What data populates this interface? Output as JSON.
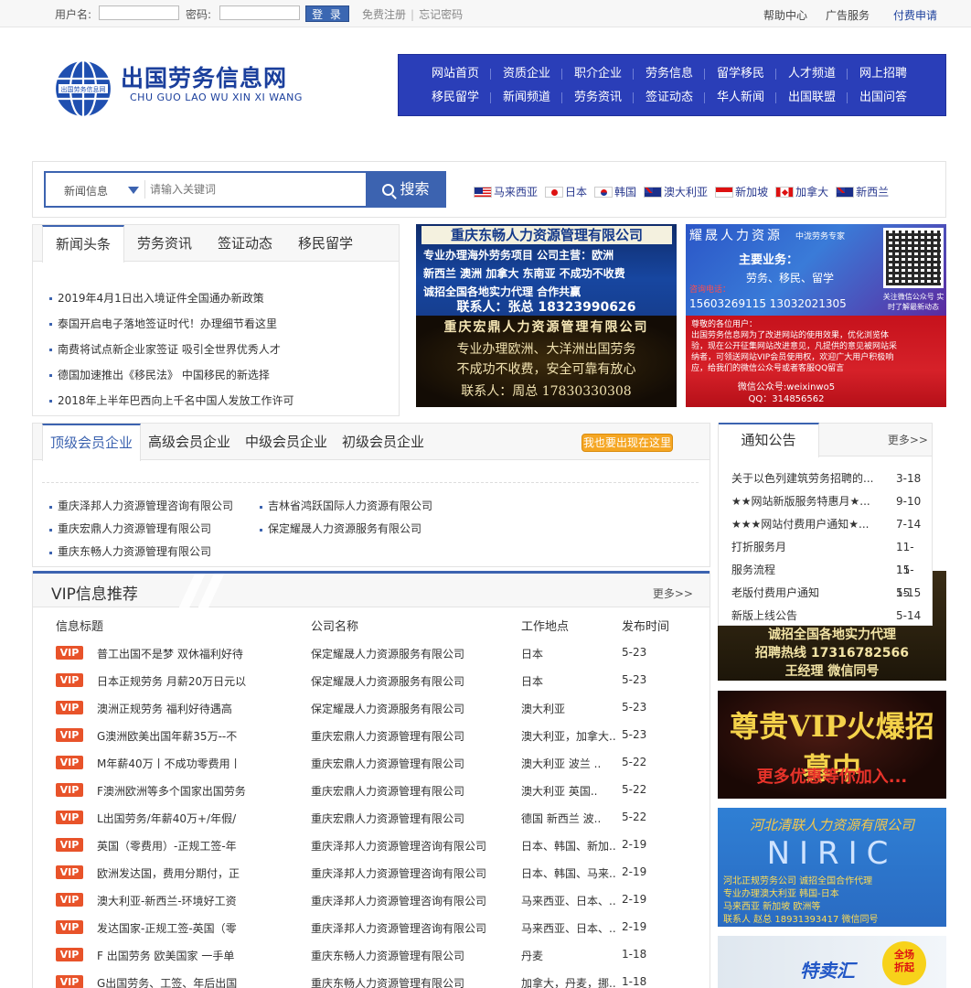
{
  "topbar": {
    "username_label": "用户名:",
    "password_label": "密码:",
    "login_label": "登 录",
    "register": "免费注册",
    "forgot": "忘记密码",
    "help": "帮助中心",
    "ads": "广告服务",
    "paid": "付费申请"
  },
  "logo": {
    "badge_text": "出国劳务信息网",
    "title": "出国劳务信息网",
    "subtitle": "CHU GUO LAO WU XIN XI WANG"
  },
  "nav": {
    "row1": [
      "网站首页",
      "资质企业",
      "职介企业",
      "劳务信息",
      "留学移民",
      "人才频道",
      "网上招聘"
    ],
    "row2": [
      "移民留学",
      "新闻频道",
      "劳务资讯",
      "签证动态",
      "华人新闻",
      "出国联盟",
      "出国问答"
    ]
  },
  "search": {
    "category": "新闻信息",
    "placeholder": "请输入关键词",
    "button": "搜索"
  },
  "flags": [
    "马来西亚",
    "日本",
    "韩国",
    "澳大利亚",
    "新加坡",
    "加拿大",
    "新西兰"
  ],
  "news": {
    "tabs": [
      "新闻头条",
      "劳务资讯",
      "签证动态",
      "移民留学"
    ],
    "items": [
      "2019年4月1日出入境证件全国通办新政策",
      "泰国开启电子落地签证时代！办理细节看这里",
      "南费将试点新企业家签证 吸引全世界优秀人才",
      "德国加速推出《移民法》 中国移民的新选择",
      "2018年上半年巴西向上千名中国人发放工作许可"
    ]
  },
  "ads": {
    "ad1_title": "重庆东畅人力资源管理有限公司",
    "ad1_line1": "专业办理海外劳务项目    公司主营：欧洲",
    "ad1_line2": "新西兰 澳洲 加拿大 东南亚   不成功不收费",
    "ad1_line3": "诚招全国各地实力代理    合作共赢",
    "ad1_contact": "联系人：张总  18323990626",
    "ad2_title": "重庆宏鼎人力资源管理有限公司",
    "ad2_line1": "专业办理欧洲、大洋洲出国劳务",
    "ad2_line2": "不成功不收费，安全可靠有放心",
    "ad2_contact": "联系人：周总    17830330308",
    "ad3_title": "耀晟人力资源",
    "ad3_tag": "中泷劳务专家",
    "ad3_business_label": "主要业务：",
    "ad3_business": "劳务、移民、留学",
    "ad3_hotline_label": "咨询电话：",
    "ad3_phones": "15603269115   13032021305",
    "ad3_qr_caption": "关注微信公众号 实时了解最新动态",
    "ad4_greeting": "尊敬的各位用户：",
    "ad4_body": "出国劳务信息网为了改进网站的使用效果，优化浏览体验，现在公开征集网站改进意见，凡提供的意见被网站采纳者，可领送网站VIP会员使用权，欢迎广大用户积极响应，给我们的微信公众号或者客服QQ留言",
    "ad4_wechat": "微信公众号:weixinwo5",
    "ad4_qq": "QQ：314856562"
  },
  "members": {
    "tabs": [
      "顶级会员企业",
      "高级会员企业",
      "中级会员企业",
      "初级会员企业"
    ],
    "join": "我也要出现在这里",
    "col1": [
      "重庆泽邦人力资源管理咨询有限公司",
      "重庆宏鼎人力资源管理有限公司",
      "重庆东畅人力资源管理有限公司"
    ],
    "col2": [
      "吉林省鸿跃国际人力资源有限公司",
      "保定耀晟人力资源服务有限公司"
    ]
  },
  "notice": {
    "title": "通知公告",
    "more": "更多>>",
    "items": [
      {
        "title": "关于以色列建筑劳务招聘的...",
        "date": "3-18"
      },
      {
        "title": "★★网站新版服务特惠月★...",
        "date": "9-10"
      },
      {
        "title": "★★★网站付费用户通知★...",
        "date": "7-14"
      },
      {
        "title": "打折服务月",
        "date": "11-15"
      },
      {
        "title": "服务流程",
        "date": "11-15"
      },
      {
        "title": "老版付费用户通知",
        "date": "5-15"
      },
      {
        "title": "新版上线公告",
        "date": "5-14"
      }
    ]
  },
  "right_ads": {
    "rad1_line1": "诚招全国各地实力代理",
    "rad1_line2": "招聘热线  17316782566",
    "rad1_line3": "王经理   微信同号",
    "rad2_title": "尊贵VIP火爆招募中",
    "rad2_sub": "更多优惠等你加入...",
    "rad3_title": "河北清联人力资源有限公司",
    "rad3_brand": "NIRIC",
    "rad3_line1": "河北正规劳务公司  诚招全国合作代理",
    "rad3_line2": "专业办理澳大利亚 韩国-日本",
    "rad3_line3": "马来西亚 新加坡 欧洲等",
    "rad3_contact": "联系人 赵总 18931393417 微信同号",
    "rad4_title": "特卖汇",
    "rad4_badge_line1": "全场",
    "rad4_badge_line2": "折起"
  },
  "vip": {
    "title": "VIP信息推荐",
    "more": "更多>>",
    "columns": [
      "信息标题",
      "公司名称",
      "工作地点",
      "发布时间"
    ],
    "badge": "VIP",
    "rows": [
      {
        "title": "普工出国不是梦 双休福利好待",
        "company": "保定耀晟人力资源服务有限公司",
        "location": "日本",
        "date": "5-23"
      },
      {
        "title": "日本正规劳务 月薪20万日元以",
        "company": "保定耀晟人力资源服务有限公司",
        "location": "日本",
        "date": "5-23"
      },
      {
        "title": "澳洲正规劳务 福利好待遇高",
        "company": "保定耀晟人力资源服务有限公司",
        "location": "澳大利亚",
        "date": "5-23"
      },
      {
        "title": "G澳洲欧美出国年薪35万--不",
        "company": "重庆宏鼎人力资源管理有限公司",
        "location": "澳大利亚，加拿大..",
        "date": "5-23"
      },
      {
        "title": "M年薪40万丨不成功零费用丨",
        "company": "重庆宏鼎人力资源管理有限公司",
        "location": "澳大利亚 波兰 ..",
        "date": "5-22"
      },
      {
        "title": "F澳洲欧洲等多个国家出国劳务",
        "company": "重庆宏鼎人力资源管理有限公司",
        "location": "澳大利亚 英国..",
        "date": "5-22"
      },
      {
        "title": "L出国劳务/年薪40万+/年假/",
        "company": "重庆宏鼎人力资源管理有限公司",
        "location": "德国 新西兰 波..",
        "date": "5-22"
      },
      {
        "title": "英国（零费用）-正规工签-年",
        "company": "重庆泽邦人力资源管理咨询有限公司",
        "location": "日本、韩国、新加..",
        "date": "2-19"
      },
      {
        "title": "欧洲发达国，费用分期付，正",
        "company": "重庆泽邦人力资源管理咨询有限公司",
        "location": "日本、韩国、马来..",
        "date": "2-19"
      },
      {
        "title": "澳大利亚-新西兰-环境好工资",
        "company": "重庆泽邦人力资源管理咨询有限公司",
        "location": "马来西亚、日本、..",
        "date": "2-19"
      },
      {
        "title": "发达国家-正规工签-英国（零",
        "company": "重庆泽邦人力资源管理咨询有限公司",
        "location": "马来西亚、日本、..",
        "date": "2-19"
      },
      {
        "title": "F 出国劳务 欧美国家 一手单",
        "company": "重庆东畅人力资源管理有限公司",
        "location": "丹麦",
        "date": "1-18"
      },
      {
        "title": "G出国劳务、工签、年后出国",
        "company": "重庆东畅人力资源管理有限公司",
        "location": "加拿大，丹麦，挪..",
        "date": "1-18"
      }
    ]
  }
}
